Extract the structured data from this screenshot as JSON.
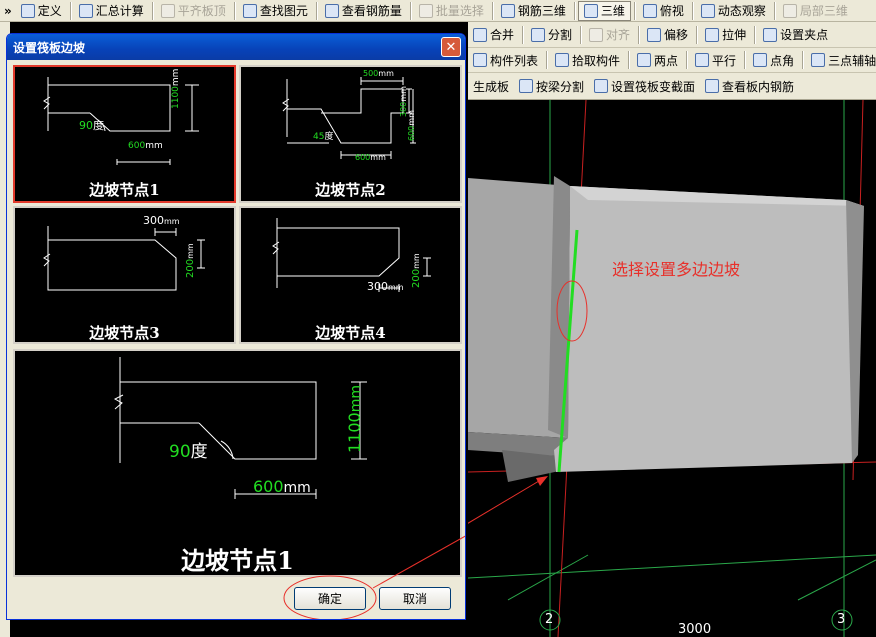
{
  "toolbar_top": {
    "items": [
      {
        "key": "define",
        "label": "定义",
        "icon": "define-icon",
        "state": ""
      },
      {
        "key": "summary",
        "label": "汇总计算",
        "icon": "sigma-icon",
        "state": ""
      },
      {
        "key": "level",
        "label": "平齐板顶",
        "icon": "level-icon",
        "state": "dis"
      },
      {
        "key": "find",
        "label": "查找图元",
        "icon": "binoculars-icon",
        "state": ""
      },
      {
        "key": "rebar",
        "label": "查看钢筋量",
        "icon": "rebar-icon",
        "state": ""
      },
      {
        "key": "batch",
        "label": "批量选择",
        "icon": "batch-select-icon",
        "state": "dis"
      },
      {
        "key": "rebar3d",
        "label": "钢筋三维",
        "icon": "rebar-3d-icon",
        "state": ""
      },
      {
        "key": "view3d",
        "label": "三维",
        "icon": "cube-icon",
        "state": "sel"
      },
      {
        "key": "top",
        "label": "俯视",
        "icon": "top-view-icon",
        "state": ""
      },
      {
        "key": "orbit",
        "label": "动态观察",
        "icon": "orbit-icon",
        "state": ""
      },
      {
        "key": "partial",
        "label": "局部三维",
        "icon": "partial-3d-icon",
        "state": "dis"
      }
    ]
  },
  "toolbar_edit": {
    "items": [
      {
        "key": "merge",
        "label": "合并",
        "icon": "merge-icon",
        "state": ""
      },
      {
        "key": "split",
        "label": "分割",
        "icon": "split-icon",
        "state": ""
      },
      {
        "key": "align",
        "label": "对齐",
        "icon": "align-icon",
        "state": "dis"
      },
      {
        "key": "offset",
        "label": "偏移",
        "icon": "offset-icon",
        "state": ""
      },
      {
        "key": "stretch",
        "label": "拉伸",
        "icon": "stretch-icon",
        "state": ""
      },
      {
        "key": "grip",
        "label": "设置夹点",
        "icon": "grip-icon",
        "state": ""
      }
    ]
  },
  "toolbar_draw": {
    "items": [
      {
        "key": "list",
        "label": "构件列表",
        "icon": "list-icon",
        "state": ""
      },
      {
        "key": "pick",
        "label": "拾取构件",
        "icon": "pick-icon",
        "state": ""
      },
      {
        "key": "twopoint",
        "label": "两点",
        "icon": "two-point-icon",
        "state": ""
      },
      {
        "key": "parallel",
        "label": "平行",
        "icon": "parallel-icon",
        "state": ""
      },
      {
        "key": "angle",
        "label": "点角",
        "icon": "point-angle-icon",
        "state": ""
      },
      {
        "key": "threepoint",
        "label": "三点辅轴",
        "icon": "three-point-axis-icon",
        "state": ""
      }
    ]
  },
  "toolbar_slab": {
    "items": [
      {
        "key": "generate",
        "label": "生成板",
        "icon": "",
        "state": ""
      },
      {
        "key": "beamsplit",
        "label": "按梁分割",
        "icon": "beam-split-icon",
        "state": ""
      },
      {
        "key": "section",
        "label": "设置筏板变截面",
        "icon": "slab-section-icon",
        "state": ""
      },
      {
        "key": "inner",
        "label": "查看板内钢筋",
        "icon": "view-rebar-icon",
        "state": ""
      }
    ]
  },
  "dialog": {
    "title": "设置筏板边坡",
    "ok": "确定",
    "cancel": "取消",
    "close": "✕"
  },
  "options": [
    {
      "label": "边坡节点1",
      "dims": [
        "1100",
        "600",
        "90"
      ],
      "units": [
        "mm",
        "mm",
        "度"
      ],
      "selected": true
    },
    {
      "label": "边坡节点2",
      "dims": [
        "500",
        "300",
        "600",
        "45",
        "600"
      ],
      "units": [
        "mm",
        "mm",
        "mm",
        "度",
        "mm"
      ],
      "selected": false
    },
    {
      "label": "边坡节点3",
      "dims": [
        "300",
        "200"
      ],
      "units": [
        "mm",
        "mm"
      ],
      "selected": false
    },
    {
      "label": "边坡节点4",
      "dims": [
        "200",
        "300"
      ],
      "units": [
        "mm",
        "mm"
      ],
      "selected": false
    }
  ],
  "preview": {
    "label": "边坡节点1",
    "dims": [
      "1100",
      "600",
      "90"
    ],
    "units": [
      "mm",
      "mm",
      "度"
    ]
  },
  "viewport": {
    "annotation": "选择设置多边边坡",
    "axis_labels": [
      "2",
      "3"
    ],
    "dimension": "3000"
  },
  "colors": {
    "annotation": "#e8302a",
    "highlight_edge": "#22dd22",
    "dim_text": "#22dd22",
    "slab": "#b4b4b4",
    "grid": "#2aa84a"
  }
}
